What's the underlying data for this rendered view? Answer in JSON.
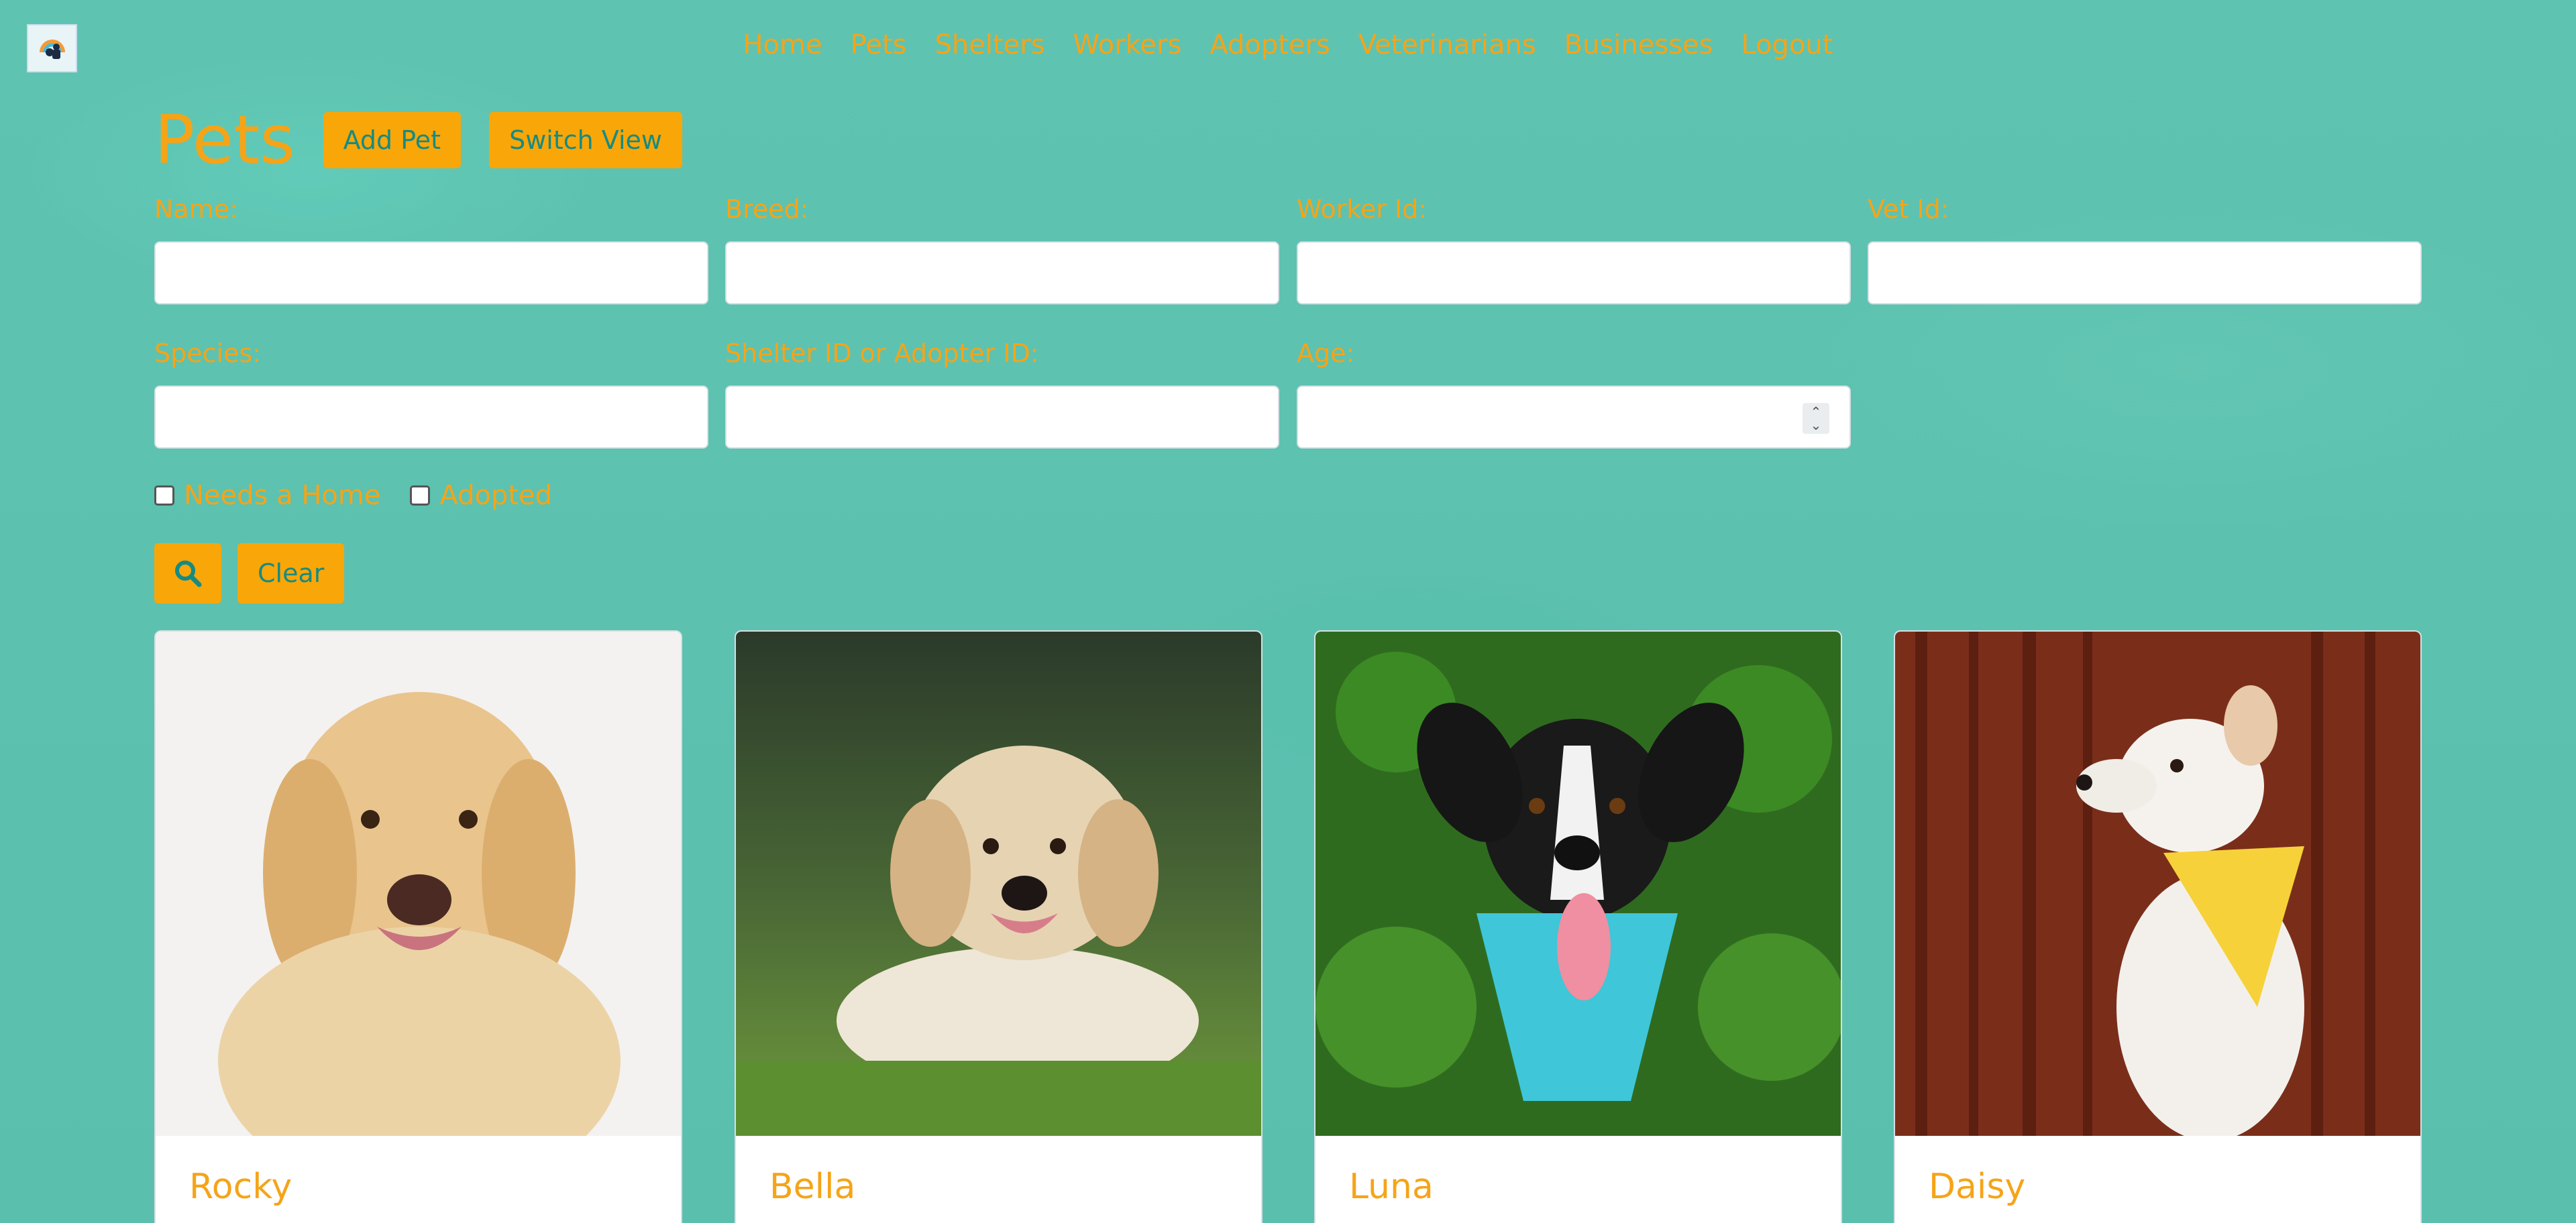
{
  "nav": {
    "items": [
      "Home",
      "Pets",
      "Shelters",
      "Workers",
      "Adopters",
      "Veterinarians",
      "Businesses",
      "Logout"
    ]
  },
  "header": {
    "title": "Pets",
    "add_label": "Add Pet",
    "switch_label": "Switch View"
  },
  "filters": {
    "name_label": "Name:",
    "breed_label": "Breed:",
    "worker_label": "Worker Id:",
    "vet_label": "Vet Id:",
    "species_label": "Species:",
    "shelter_label": "Shelter ID or Adopter ID:",
    "age_label": "Age:",
    "needs_home_label": "Needs a Home",
    "adopted_label": "Adopted",
    "clear_label": "Clear"
  },
  "pets": [
    {
      "name": "Rocky"
    },
    {
      "name": "Bella"
    },
    {
      "name": "Luna"
    },
    {
      "name": "Daisy"
    }
  ],
  "colors": {
    "background": "#5ec2b0",
    "accent": "#f9a608",
    "accent_text": "#168b82",
    "label": "#f5a418"
  }
}
